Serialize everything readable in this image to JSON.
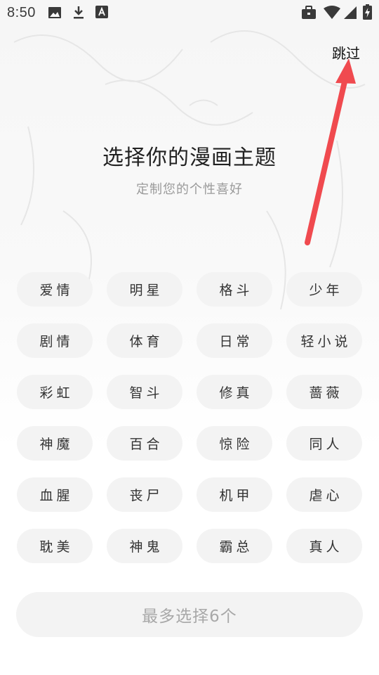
{
  "status_bar": {
    "time": "8:50",
    "left_icons": [
      "image-icon",
      "download-icon",
      "a-badge-icon"
    ],
    "right_icons": [
      "briefcase-icon",
      "wifi-icon",
      "signal-icon",
      "battery-charging-icon"
    ]
  },
  "skip_label": "跳过",
  "title": "选择你的漫画主题",
  "subtitle": "定制您的个性喜好",
  "themes": [
    "爱情",
    "明星",
    "格斗",
    "少年",
    "剧情",
    "体育",
    "日常",
    "轻小说",
    "彩虹",
    "智斗",
    "修真",
    "蔷薇",
    "神魔",
    "百合",
    "惊险",
    "同人",
    "血腥",
    "丧尸",
    "机甲",
    "虐心",
    "耽美",
    "神鬼",
    "霸总",
    "真人"
  ],
  "confirm_label": "最多选择6个",
  "colors": {
    "chip_bg": "#f3f3f3",
    "arrow": "#f04a4f",
    "subtitle": "#9a9a9a",
    "disabled_text": "#a8a8a8"
  }
}
